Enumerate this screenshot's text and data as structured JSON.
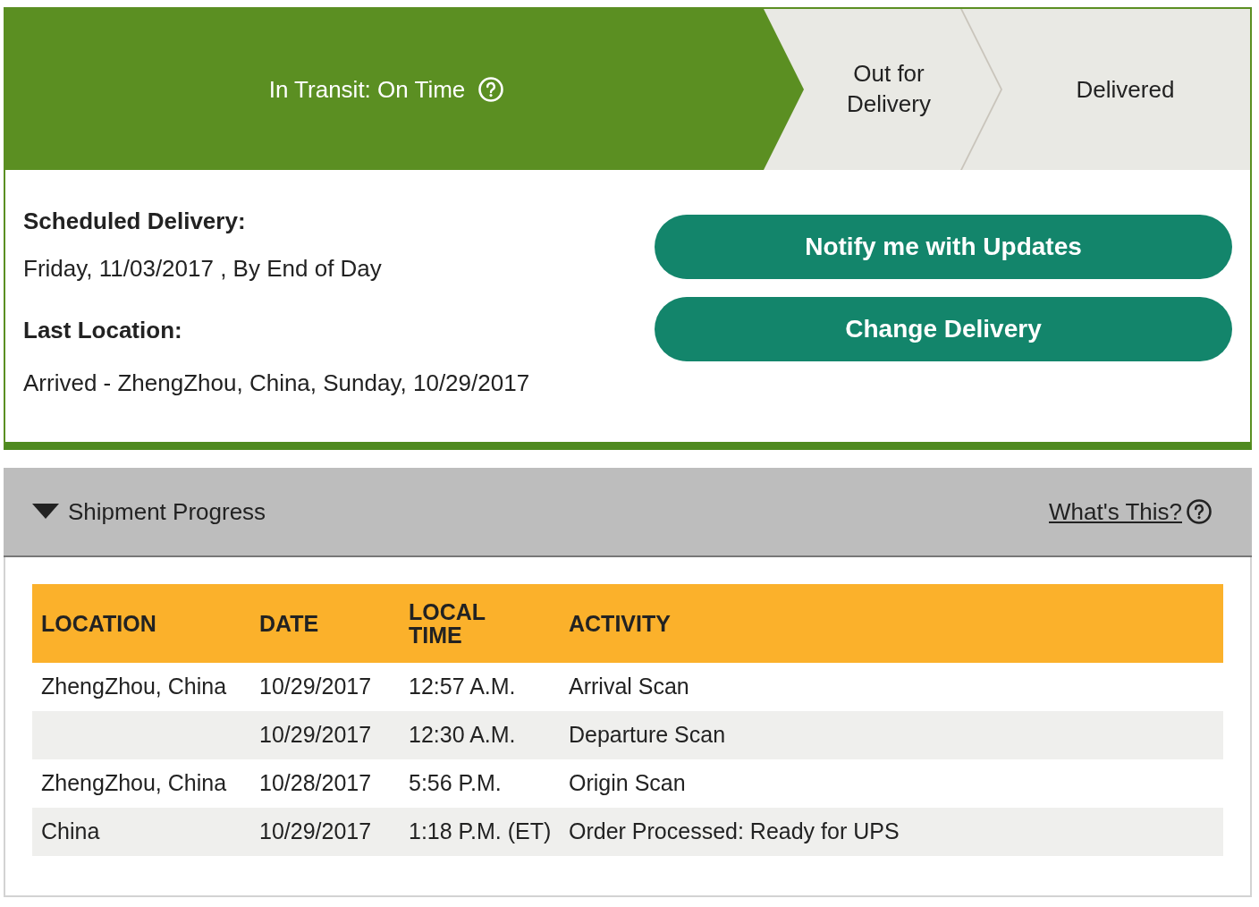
{
  "status_steps": [
    {
      "label": "In Transit: On Time",
      "selected": true,
      "help": true
    },
    {
      "label": "Out for Delivery",
      "selected": false
    },
    {
      "label": "Delivered",
      "selected": false
    }
  ],
  "delivery": {
    "scheduled_label": "Scheduled Delivery:",
    "scheduled_value": "Friday, 11/03/2017 , By End of Day",
    "last_location_label": "Last Location:",
    "last_location_value": "Arrived - ZhengZhou, China, Sunday, 10/29/2017"
  },
  "buttons": [
    "Notify me with Updates",
    "Change Delivery"
  ],
  "progress": {
    "title": "Shipment Progress",
    "expanded": true,
    "help_link": "What's This?",
    "table": {
      "columns": [
        "LOCATION",
        "DATE",
        "LOCAL TIME",
        "ACTIVITY"
      ],
      "rows": [
        {
          "location": "ZhengZhou,  China",
          "date": "10/29/2017",
          "time": "12:57 A.M.",
          "activity": "Arrival Scan"
        },
        {
          "date": "10/29/2017",
          "time": "12:30 A.M.",
          "activity": "Departure Scan"
        },
        {
          "location": "ZhengZhou,  China",
          "date": "10/28/2017",
          "time": "5:56 P.M.",
          "activity": "Origin Scan"
        },
        {
          "location": "China",
          "date": "10/29/2017",
          "time": "1:18 P.M. (ET)",
          "activity": "Order Processed: Ready for UPS"
        }
      ]
    }
  }
}
